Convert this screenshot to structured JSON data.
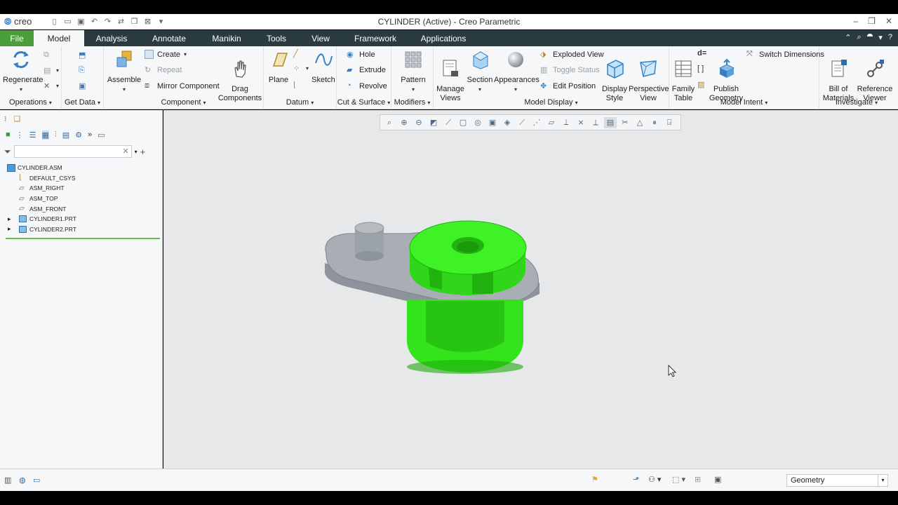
{
  "window": {
    "title": "CYLINDER (Active) - Creo Parametric",
    "logo_text": "creo",
    "minimize": "–",
    "restore": "❐",
    "close": "✕"
  },
  "tabs": [
    {
      "label": "File",
      "active": false
    },
    {
      "label": "Model",
      "active": true
    },
    {
      "label": "Analysis",
      "active": false
    },
    {
      "label": "Annotate",
      "active": false
    },
    {
      "label": "Manikin",
      "active": false
    },
    {
      "label": "Tools",
      "active": false
    },
    {
      "label": "View",
      "active": false
    },
    {
      "label": "Framework",
      "active": false
    },
    {
      "label": "Applications",
      "active": false
    }
  ],
  "ribbon": {
    "operations": {
      "label": "Operations",
      "regenerate": "Regenerate"
    },
    "get_data": {
      "label": "Get Data"
    },
    "component": {
      "label": "Component",
      "assemble": "Assemble",
      "create": "Create",
      "repeat": "Repeat",
      "mirror": "Mirror Component",
      "drag": "Drag\nComponents"
    },
    "datum": {
      "label": "Datum",
      "plane": "Plane",
      "sketch": "Sketch"
    },
    "cut_surface": {
      "label": "Cut & Surface",
      "hole": "Hole",
      "extrude": "Extrude",
      "revolve": "Revolve"
    },
    "modifiers": {
      "label": "Modifiers",
      "pattern": "Pattern"
    },
    "model_display": {
      "label": "Model Display",
      "manage_views": "Manage\nViews",
      "section": "Section",
      "appearances": "Appearances",
      "exploded": "Exploded View",
      "toggle_status": "Toggle Status",
      "edit_position": "Edit Position",
      "display_style": "Display\nStyle",
      "perspective": "Perspective\nView"
    },
    "model_intent": {
      "label": "Model Intent",
      "family_table": "Family\nTable",
      "publish": "Publish\nGeometry",
      "switch_dims": "Switch Dimensions",
      "d_equals": "d="
    },
    "investigate": {
      "label": "Investigate",
      "bom": "Bill of\nMaterials",
      "ref_viewer": "Reference\nViewer"
    }
  },
  "tree": {
    "filter_placeholder": "",
    "items": [
      {
        "label": "CYLINDER.ASM",
        "expander": ""
      },
      {
        "label": "DEFAULT_CSYS",
        "expander": ""
      },
      {
        "label": "ASM_RIGHT",
        "expander": ""
      },
      {
        "label": "ASM_TOP",
        "expander": ""
      },
      {
        "label": "ASM_FRONT",
        "expander": ""
      },
      {
        "label": "CYLINDER1.PRT",
        "expander": "▸"
      },
      {
        "label": "CYLINDER2.PRT",
        "expander": "▸"
      }
    ]
  },
  "statusbar": {
    "selection_filter": "Geometry"
  },
  "colors": {
    "tabbar": "#2b3b42",
    "file_tab": "#4a9f3c",
    "part_green": "#33ee1c",
    "part_gray": "#a8adb3"
  }
}
